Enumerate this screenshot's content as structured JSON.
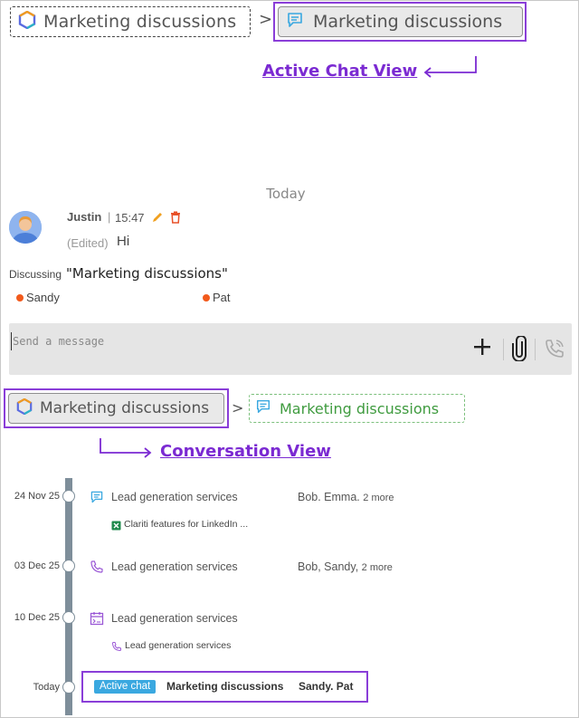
{
  "breadcrumb_top": {
    "conversation_label": "Marketing discussions",
    "active_chat_label": "Marketing discussions",
    "chevron": ">"
  },
  "callouts": {
    "active_chat_view": "Active Chat View",
    "conversation_view": "Conversation View"
  },
  "chat": {
    "day_separator": "Today",
    "message": {
      "author": "Justin",
      "separator": "|",
      "time": "15:47",
      "edited_label": "(Edited)",
      "text": "Hi"
    },
    "discussing_label": "Discussing",
    "discussing_title": "\"Marketing discussions\"",
    "participants": [
      "Sandy",
      "Pat"
    ],
    "composer_placeholder": "Send a message"
  },
  "breadcrumb_bottom": {
    "conversation_label": "Marketing discussions",
    "active_chat_label": "Marketing discussions",
    "chevron": ">"
  },
  "timeline": {
    "entries": [
      {
        "date": "24 Nov 25",
        "icon": "chat-icon",
        "title": "Lead generation services",
        "people": "Bob. Emma.",
        "more": "2 more",
        "sub": "Clariti features for LinkedIn ...",
        "sub_icon": "spreadsheet-icon"
      },
      {
        "date": "03 Dec 25",
        "icon": "phone-icon",
        "title": "Lead generation services",
        "people": "Bob, Sandy,",
        "more": "2 more"
      },
      {
        "date": "10 Dec 25",
        "icon": "calendar-icon",
        "title": "Lead generation services",
        "sub": "Lead generation services",
        "sub_icon": "phone-icon"
      }
    ],
    "active": {
      "date": "Today",
      "badge": "Active chat",
      "title": "Marketing discussions",
      "people": "Sandy. Pat"
    }
  },
  "colors": {
    "highlight": "#8a3ed8",
    "callout_text": "#7b2ad2",
    "active_chat_green": "#3f9b3f",
    "badge_blue": "#3aa8e0",
    "participant_dot": "#f25a1c",
    "timeline_bar": "#7e8e9a"
  }
}
